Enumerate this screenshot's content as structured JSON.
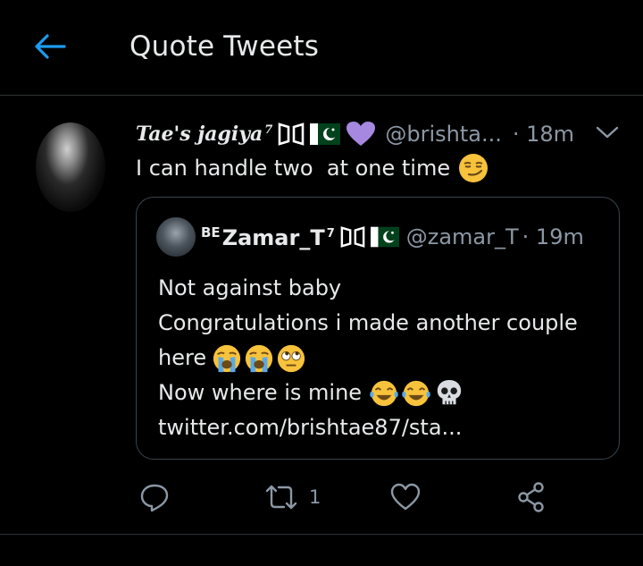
{
  "header": {
    "back_icon": "arrow-left-icon",
    "title": "Quote Tweets",
    "accent": "#1d9bf0"
  },
  "tweet": {
    "display_name": "Tae's jagiya",
    "name_superscript": "7",
    "badges": [
      "bts-logo-icon",
      "pakistan-flag-icon",
      "purple-heart-icon"
    ],
    "handle": "@brishta...",
    "time": "· 18m",
    "text": "I can handle two  at one time",
    "text_emoji": "smirking-face-icon",
    "caret_icon": "chevron-down-icon"
  },
  "quote": {
    "name_prefix": "BE",
    "display_name": "Zamar_T",
    "name_superscript": "7",
    "badges": [
      "bts-logo-icon",
      "pakistan-flag-icon"
    ],
    "handle": "@zamar_T",
    "time": "· 19m",
    "lines": [
      {
        "text": "Not against baby",
        "emojis": []
      },
      {
        "text": "Congratulations i made another couple",
        "emojis": []
      },
      {
        "text": "here",
        "emojis": [
          "crying-face-icon",
          "crying-face-icon",
          "eye-roll-face-icon"
        ]
      },
      {
        "text": "Now where is mine",
        "emojis": [
          "tears-of-joy-icon",
          "tears-of-joy-icon",
          "skull-icon"
        ]
      },
      {
        "text": "twitter.com/brishtae87/sta...",
        "emojis": []
      }
    ]
  },
  "actions": {
    "reply_icon": "reply-icon",
    "retweet_icon": "retweet-icon",
    "retweet_count": "1",
    "like_icon": "heart-icon",
    "share_icon": "share-icon"
  }
}
